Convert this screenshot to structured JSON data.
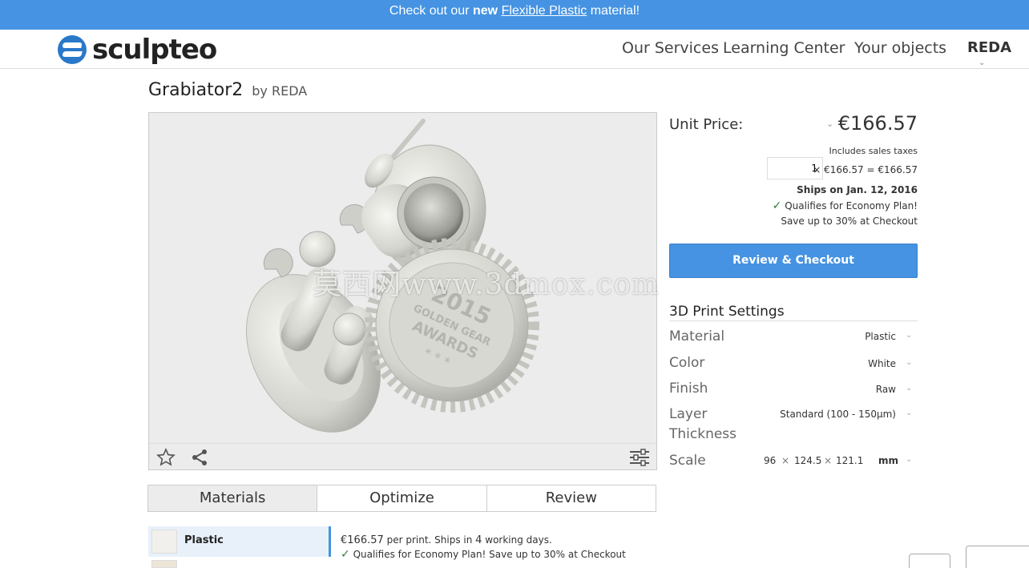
{
  "banner": {
    "prefix": "Check out our ",
    "bold": "new",
    "link": "Flexible Plastic",
    "suffix": " material!"
  },
  "nav": {
    "logo": "sculpteo",
    "links": [
      "Our Services",
      "Learning Center",
      "Your objects"
    ],
    "user": "REDA"
  },
  "product": {
    "title": "Grabiator2",
    "by": "by REDA"
  },
  "model": {
    "text_year": "2015",
    "text_line1": "GOLDEN GEAR",
    "text_line2": "AWARDS",
    "text_stars": "* * *"
  },
  "pricing": {
    "unit_label": "Unit Price:",
    "unit_price": "€166.57",
    "taxes": "Includes sales taxes",
    "quantity": "1",
    "total": "× €166.57 = €166.57",
    "ships": "Ships on Jan. 12, 2016",
    "economy": "Qualifies for Economy Plan!",
    "save": "Save up to 30% at Checkout",
    "checkout": "Review & Checkout"
  },
  "settings": {
    "title": "3D Print Settings",
    "material_label": "Material",
    "material_value": "Plastic",
    "color_label": "Color",
    "color_value": "White",
    "finish_label": "Finish",
    "finish_value": "Raw",
    "layer_label": "Layer",
    "layer_label2": "Thickness",
    "layer_value": "Standard (100 - 150µm)",
    "scale_label": "Scale",
    "scale_x": "96",
    "scale_y": "124.5",
    "scale_z": "121.1",
    "scale_sep": "×",
    "scale_unit": "mm"
  },
  "tabs": [
    "Materials",
    "Optimize",
    "Review"
  ],
  "materials": {
    "selected_name": "Plastic",
    "price": "€166.57",
    "price_suffix": " per print. Ships in ",
    "days": "4",
    "days_suffix": " working days.",
    "economy": "Qualifies for Economy Plan! Save up to 30% at Checkout"
  },
  "watermark": "莫西网www.3dmox.com",
  "colors": {
    "accent": "#4593e2",
    "check": "#2e7d32"
  }
}
